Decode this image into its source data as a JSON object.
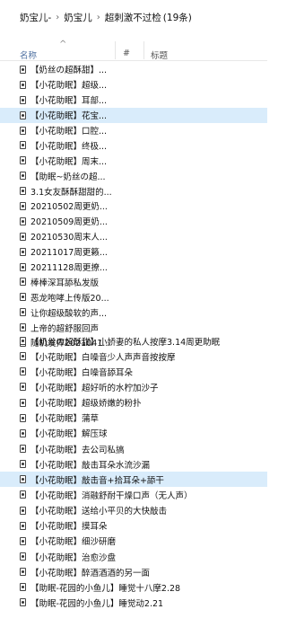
{
  "breadcrumb": {
    "items": [
      "奶宝儿-",
      "奶宝儿",
      "超刺激不过检"
    ],
    "count": "(19条)",
    "separator": "›"
  },
  "header": {
    "name": "名称",
    "sort_indicator": "^",
    "number": "#",
    "title": "标题"
  },
  "list_a": [
    "【奶丝の超酥甜】...",
    "【小花助眠】超级...",
    "【小花助眠】耳部...",
    "【小花助眠】花宝...",
    "【小花助眠】口腔...",
    "【小花助眠】终极...",
    "【小花助眠】周末...",
    "【助眠~奶丝の超...",
    "3.1女友酥酥甜甜的...",
    "20210502周更奶...",
    "20210509周更奶...",
    "20210530周末人...",
    "20211017周更籁...",
    "20211128周更撩...",
    "棒棒深耳舔私发版",
    "恶龙咆哮上传版20...",
    "让你超级酸软的声...",
    "上帝的超舒服回声",
    "随机发挥2021041..."
  ],
  "list_b": [
    "【奶丝の超酥甜】小娇妻的私人按摩3.14周更助眠",
    "【小花助眠】白噪音少人声声音按按摩",
    "【小花助眠】白噪音舔耳朵",
    "【小花助眠】超好听的水柠加沙子",
    "【小花助眠】超级娇嫩的粉扑",
    "【小花助眠】蒲草",
    "【小花助眠】解压球",
    "【小花助眠】去公司私搞",
    "【小花助眠】敲击耳朵水流沙漏",
    "【小花助眠】敲击音+拾耳朵+舔干",
    "【小花助眠】消融舒耐干燥口声（无人声）",
    "【小花助眠】送给小平贝的大快敲击",
    "【小花助眠】摸耳朵",
    "【小花助眠】细沙研磨",
    "【小花助眠】治愈沙盘",
    "【小花助眠】醉酒酒酒的另一面",
    "【助眠-花园的小鱼儿】睡觉十八摩2.28",
    "【助眠-花园的小鱼儿】睡觉动2.21"
  ],
  "selected_index_a": 3,
  "selected_index_b": 9,
  "colors": {
    "selection": "#d9ecfb",
    "header_link": "#4d6fa0"
  }
}
